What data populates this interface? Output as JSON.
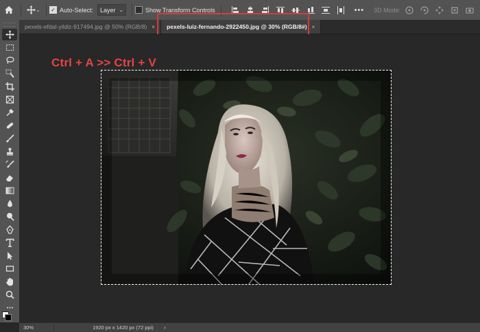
{
  "options_bar": {
    "auto_select_label": "Auto-Select:",
    "auto_select_checked": true,
    "target_select": "Layer",
    "show_transform_label": "Show Transform Controls",
    "show_transform_checked": false,
    "more_label": "•••",
    "mode_3d_label": "3D Mode:"
  },
  "tabs": [
    {
      "label": "pexels-efdal-yildiz-917494.jpg @ 50% (RGB/8)",
      "close": "×",
      "active": false
    },
    {
      "label": "pexels-luiz-fernando-2922450.jpg @ 30% (RGB/8#)",
      "close": "×",
      "active": true
    }
  ],
  "canvas": {
    "annotation": "Ctrl + A >> Ctrl + V",
    "annotation_color": "#e74343",
    "highlight_color": "#d93a3a"
  },
  "status_bar": {
    "zoom": "30%",
    "document_info": "1920 px x 1420 px (72 ppi)",
    "arrow": "›"
  },
  "toolbar": {
    "tools": [
      "move-tool",
      "marquee-tool",
      "lasso-tool",
      "quick-select-tool",
      "crop-tool",
      "frame-tool",
      "eyedropper-tool",
      "healing-tool",
      "brush-tool",
      "clone-stamp-tool",
      "history-brush-tool",
      "eraser-tool",
      "gradient-tool",
      "blur-tool",
      "dodge-tool",
      "pen-tool",
      "type-tool",
      "path-select-tool",
      "rectangle-tool",
      "hand-tool",
      "zoom-tool",
      "more-tools"
    ]
  }
}
